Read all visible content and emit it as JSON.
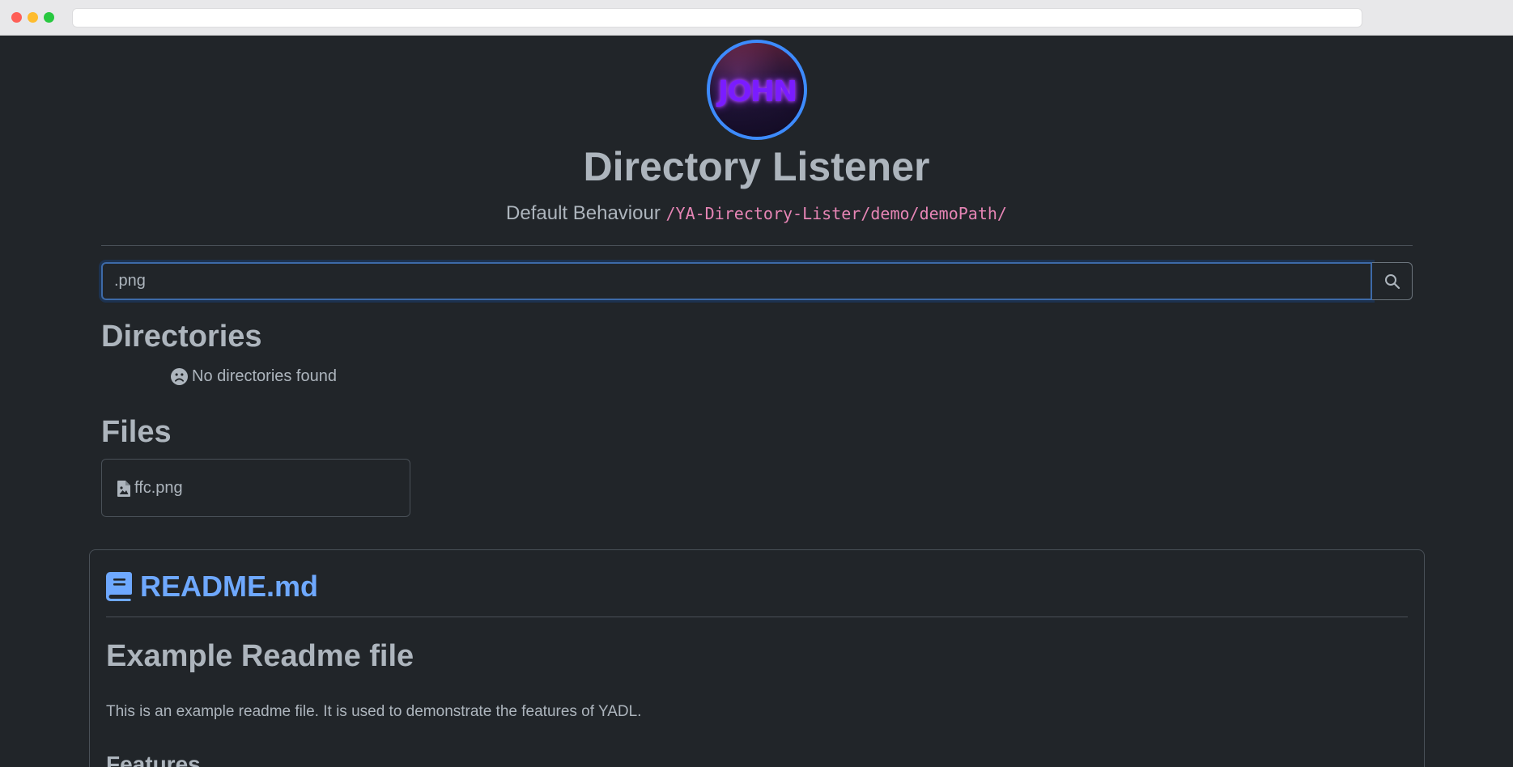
{
  "browser": {
    "address": ""
  },
  "header": {
    "avatar_text": "JOHN",
    "title": "Directory Listener",
    "subtitle": "Default Behaviour",
    "path": "/YA-Directory-Lister/demo/demoPath/"
  },
  "search": {
    "value": ".png"
  },
  "directories": {
    "heading": "Directories",
    "empty_message": "No directories found"
  },
  "files": {
    "heading": "Files",
    "items": [
      {
        "name": "ffc.png"
      }
    ]
  },
  "readme": {
    "title": "README.md",
    "h1": "Example Readme file",
    "paragraph": "This is an example readme file. It is used to demonstrate the features of YADL.",
    "h2": "Features"
  },
  "colors": {
    "background": "#212529",
    "text": "#adb5bd",
    "link": "#6ea8fe",
    "code": "#e685b5",
    "focus_border": "#3d6aa8"
  }
}
